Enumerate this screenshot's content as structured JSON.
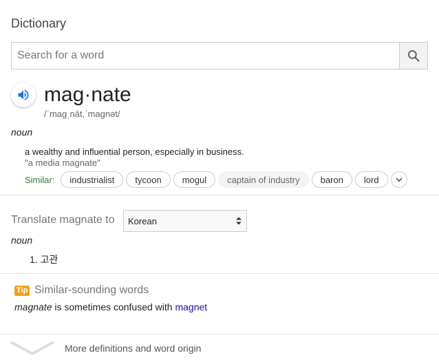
{
  "header": {
    "title": "Dictionary"
  },
  "search": {
    "placeholder": "Search for a word",
    "button_icon": "search-icon"
  },
  "entry": {
    "headword": "mag·nate",
    "pronunciation": "/ˈmaɡˌnāt,ˈmaɡnət/",
    "audio_icon": "speaker-icon",
    "part_of_speech": "noun",
    "definition": "a wealthy and influential person, especially in business.",
    "example": "\"a media magnate\"",
    "similar_label": "Similar:",
    "similar": [
      "industrialist",
      "tycoon",
      "mogul",
      "captain of industry",
      "baron",
      "lord"
    ]
  },
  "translate": {
    "label": "Translate magnate to",
    "language": "Korean",
    "part_of_speech": "noun",
    "translation": "1. 고관"
  },
  "tip": {
    "badge": "Tip",
    "title": "Similar-sounding words",
    "word": "magnate",
    "text": " is sometimes confused with ",
    "link": "magnet"
  },
  "footer": {
    "more_label": "More definitions and word origin"
  },
  "colors": {
    "accent_blue": "#1a73e8",
    "similar_green": "#3a7d3a",
    "tip_orange": "#f4a11a",
    "link": "#1a0dab"
  }
}
